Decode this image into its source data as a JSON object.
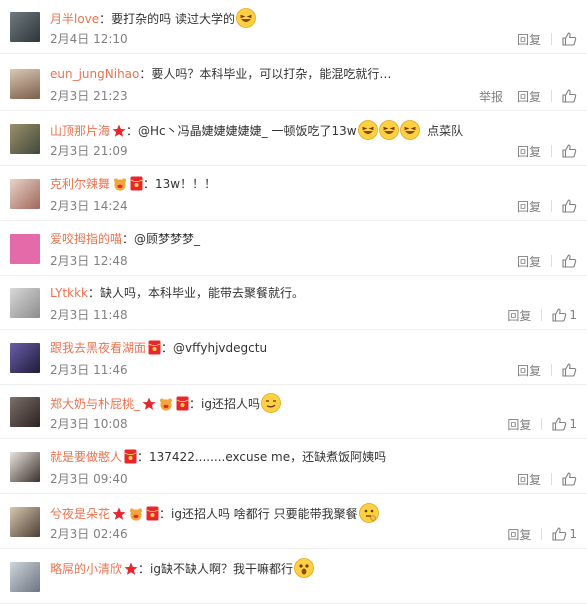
{
  "comments": [
    {
      "user": "月半love",
      "badges": [],
      "text": "：要打杂的吗 读过大学的",
      "emoji": [
        "laugh"
      ],
      "text2": "",
      "time": "2月4日 12:10",
      "report": "",
      "reply": "回复",
      "likes": ""
    },
    {
      "user": "eun_jungNihao",
      "badges": [],
      "text": "：要人吗？本科毕业，可以打杂，能混吃就行…",
      "emoji": [],
      "text2": "",
      "time": "2月3日 21:23",
      "report": "举报",
      "reply": "回复",
      "likes": ""
    },
    {
      "user": "山顶那片海",
      "badges": [
        "star"
      ],
      "text": "：@Hc丶冯晶婕婕婕婕婕_  一顿饭吃了13w",
      "emoji": [
        "laugh",
        "laugh",
        "laugh"
      ],
      "text2": "  点菜队",
      "time": "2月3日 21:09",
      "report": "",
      "reply": "回复",
      "likes": ""
    },
    {
      "user": "克利尔辣舞",
      "badges": [
        "pig",
        "redpacket"
      ],
      "text": "：13w！！！",
      "emoji": [],
      "text2": "",
      "time": "2月3日 14:24",
      "report": "",
      "reply": "回复",
      "likes": ""
    },
    {
      "user": "爱咬拇指的喵",
      "badges": [],
      "text": "：@顾梦梦梦_",
      "emoji": [],
      "text2": "",
      "time": "2月3日 12:48",
      "report": "",
      "reply": "回复",
      "likes": ""
    },
    {
      "user": "LYtkkk",
      "badges": [],
      "text": "：缺人吗，本科毕业，能带去聚餐就行。",
      "emoji": [],
      "text2": "",
      "time": "2月3日 11:48",
      "report": "",
      "reply": "回复",
      "likes": "1"
    },
    {
      "user": "跟我去黑夜看湖面",
      "badges": [
        "redpacket"
      ],
      "text": "：@vffyhjvdegctu",
      "emoji": [],
      "text2": "",
      "time": "2月3日 11:46",
      "report": "",
      "reply": "回复",
      "likes": ""
    },
    {
      "user": "郑大奶与朴屁桃_",
      "badges": [
        "star",
        "pig",
        "redpacket"
      ],
      "text": "：ig还招人吗",
      "emoji": [
        "smirk"
      ],
      "text2": "",
      "time": "2月3日 10:08",
      "report": "",
      "reply": "回复",
      "likes": "1"
    },
    {
      "user": "就是要做憨人",
      "badges": [
        "redpacket"
      ],
      "text": "：137422........excuse me，还缺煮饭阿姨吗",
      "emoji": [],
      "text2": "",
      "time": "2月3日 09:40",
      "report": "",
      "reply": "回复",
      "likes": ""
    },
    {
      "user": "兮夜是朵花",
      "badges": [
        "star",
        "pig",
        "redpacket"
      ],
      "text": "：ig还招人吗 啥都行 只要能带我聚餐",
      "emoji": [
        "think"
      ],
      "text2": "",
      "time": "2月3日 02:46",
      "report": "",
      "reply": "回复",
      "likes": "1"
    },
    {
      "user": "略屌的小清欣",
      "badges": [
        "star"
      ],
      "text": "：ig缺不缺人啊？我干嘛都行",
      "emoji": [
        "shock"
      ],
      "text2": "",
      "time": "",
      "report": "",
      "reply": "",
      "likes": ""
    }
  ],
  "colors": {
    "username": "#eb7350",
    "time": "#808080",
    "text": "#333333"
  }
}
